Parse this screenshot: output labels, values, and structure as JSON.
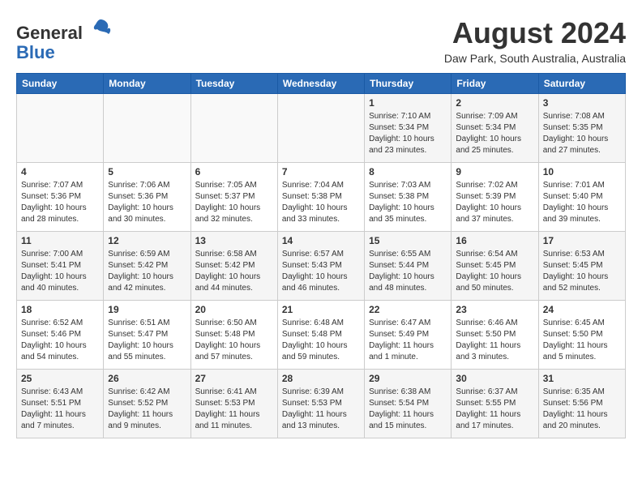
{
  "header": {
    "logo_line1": "General",
    "logo_line2": "Blue",
    "month_year": "August 2024",
    "location": "Daw Park, South Australia, Australia"
  },
  "weekdays": [
    "Sunday",
    "Monday",
    "Tuesday",
    "Wednesday",
    "Thursday",
    "Friday",
    "Saturday"
  ],
  "weeks": [
    [
      {
        "day": "",
        "info": ""
      },
      {
        "day": "",
        "info": ""
      },
      {
        "day": "",
        "info": ""
      },
      {
        "day": "",
        "info": ""
      },
      {
        "day": "1",
        "info": "Sunrise: 7:10 AM\nSunset: 5:34 PM\nDaylight: 10 hours\nand 23 minutes."
      },
      {
        "day": "2",
        "info": "Sunrise: 7:09 AM\nSunset: 5:34 PM\nDaylight: 10 hours\nand 25 minutes."
      },
      {
        "day": "3",
        "info": "Sunrise: 7:08 AM\nSunset: 5:35 PM\nDaylight: 10 hours\nand 27 minutes."
      }
    ],
    [
      {
        "day": "4",
        "info": "Sunrise: 7:07 AM\nSunset: 5:36 PM\nDaylight: 10 hours\nand 28 minutes."
      },
      {
        "day": "5",
        "info": "Sunrise: 7:06 AM\nSunset: 5:36 PM\nDaylight: 10 hours\nand 30 minutes."
      },
      {
        "day": "6",
        "info": "Sunrise: 7:05 AM\nSunset: 5:37 PM\nDaylight: 10 hours\nand 32 minutes."
      },
      {
        "day": "7",
        "info": "Sunrise: 7:04 AM\nSunset: 5:38 PM\nDaylight: 10 hours\nand 33 minutes."
      },
      {
        "day": "8",
        "info": "Sunrise: 7:03 AM\nSunset: 5:38 PM\nDaylight: 10 hours\nand 35 minutes."
      },
      {
        "day": "9",
        "info": "Sunrise: 7:02 AM\nSunset: 5:39 PM\nDaylight: 10 hours\nand 37 minutes."
      },
      {
        "day": "10",
        "info": "Sunrise: 7:01 AM\nSunset: 5:40 PM\nDaylight: 10 hours\nand 39 minutes."
      }
    ],
    [
      {
        "day": "11",
        "info": "Sunrise: 7:00 AM\nSunset: 5:41 PM\nDaylight: 10 hours\nand 40 minutes."
      },
      {
        "day": "12",
        "info": "Sunrise: 6:59 AM\nSunset: 5:42 PM\nDaylight: 10 hours\nand 42 minutes."
      },
      {
        "day": "13",
        "info": "Sunrise: 6:58 AM\nSunset: 5:42 PM\nDaylight: 10 hours\nand 44 minutes."
      },
      {
        "day": "14",
        "info": "Sunrise: 6:57 AM\nSunset: 5:43 PM\nDaylight: 10 hours\nand 46 minutes."
      },
      {
        "day": "15",
        "info": "Sunrise: 6:55 AM\nSunset: 5:44 PM\nDaylight: 10 hours\nand 48 minutes."
      },
      {
        "day": "16",
        "info": "Sunrise: 6:54 AM\nSunset: 5:45 PM\nDaylight: 10 hours\nand 50 minutes."
      },
      {
        "day": "17",
        "info": "Sunrise: 6:53 AM\nSunset: 5:45 PM\nDaylight: 10 hours\nand 52 minutes."
      }
    ],
    [
      {
        "day": "18",
        "info": "Sunrise: 6:52 AM\nSunset: 5:46 PM\nDaylight: 10 hours\nand 54 minutes."
      },
      {
        "day": "19",
        "info": "Sunrise: 6:51 AM\nSunset: 5:47 PM\nDaylight: 10 hours\nand 55 minutes."
      },
      {
        "day": "20",
        "info": "Sunrise: 6:50 AM\nSunset: 5:48 PM\nDaylight: 10 hours\nand 57 minutes."
      },
      {
        "day": "21",
        "info": "Sunrise: 6:48 AM\nSunset: 5:48 PM\nDaylight: 10 hours\nand 59 minutes."
      },
      {
        "day": "22",
        "info": "Sunrise: 6:47 AM\nSunset: 5:49 PM\nDaylight: 11 hours\nand 1 minute."
      },
      {
        "day": "23",
        "info": "Sunrise: 6:46 AM\nSunset: 5:50 PM\nDaylight: 11 hours\nand 3 minutes."
      },
      {
        "day": "24",
        "info": "Sunrise: 6:45 AM\nSunset: 5:50 PM\nDaylight: 11 hours\nand 5 minutes."
      }
    ],
    [
      {
        "day": "25",
        "info": "Sunrise: 6:43 AM\nSunset: 5:51 PM\nDaylight: 11 hours\nand 7 minutes."
      },
      {
        "day": "26",
        "info": "Sunrise: 6:42 AM\nSunset: 5:52 PM\nDaylight: 11 hours\nand 9 minutes."
      },
      {
        "day": "27",
        "info": "Sunrise: 6:41 AM\nSunset: 5:53 PM\nDaylight: 11 hours\nand 11 minutes."
      },
      {
        "day": "28",
        "info": "Sunrise: 6:39 AM\nSunset: 5:53 PM\nDaylight: 11 hours\nand 13 minutes."
      },
      {
        "day": "29",
        "info": "Sunrise: 6:38 AM\nSunset: 5:54 PM\nDaylight: 11 hours\nand 15 minutes."
      },
      {
        "day": "30",
        "info": "Sunrise: 6:37 AM\nSunset: 5:55 PM\nDaylight: 11 hours\nand 17 minutes."
      },
      {
        "day": "31",
        "info": "Sunrise: 6:35 AM\nSunset: 5:56 PM\nDaylight: 11 hours\nand 20 minutes."
      }
    ]
  ]
}
